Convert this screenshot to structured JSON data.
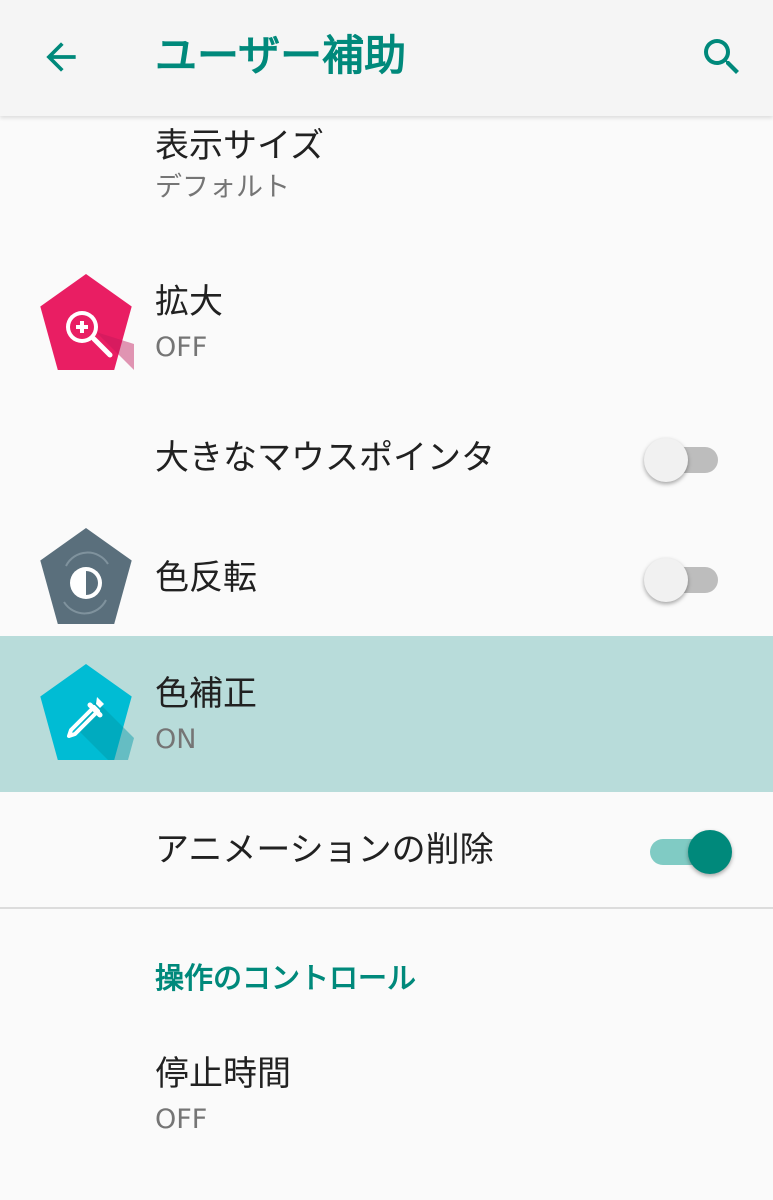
{
  "app_bar": {
    "title": "ユーザー補助",
    "back_icon": "arrow-back-icon",
    "search_icon": "search-icon",
    "accent_color": "#00897b"
  },
  "settings": {
    "display_size": {
      "title": "表示サイズ",
      "summary": "デフォルト"
    },
    "magnification": {
      "title": "拡大",
      "summary": "OFF",
      "icon": "magnify-plus-icon",
      "icon_color": "#e91e63"
    },
    "large_pointer": {
      "title": "大きなマウスポインタ",
      "enabled": false
    },
    "color_inversion": {
      "title": "色反転",
      "enabled": false,
      "icon": "invert-colors-icon",
      "icon_color": "#5a6f7c"
    },
    "color_correction": {
      "title": "色補正",
      "summary": "ON",
      "icon": "eyedropper-icon",
      "icon_color": "#00bcd4",
      "highlighted": true
    },
    "remove_animations": {
      "title": "アニメーションの削除",
      "enabled": true
    }
  },
  "sections": {
    "interaction_controls": {
      "header": "操作のコントロール",
      "dwell_time": {
        "title": "停止時間",
        "summary": "OFF"
      }
    }
  }
}
